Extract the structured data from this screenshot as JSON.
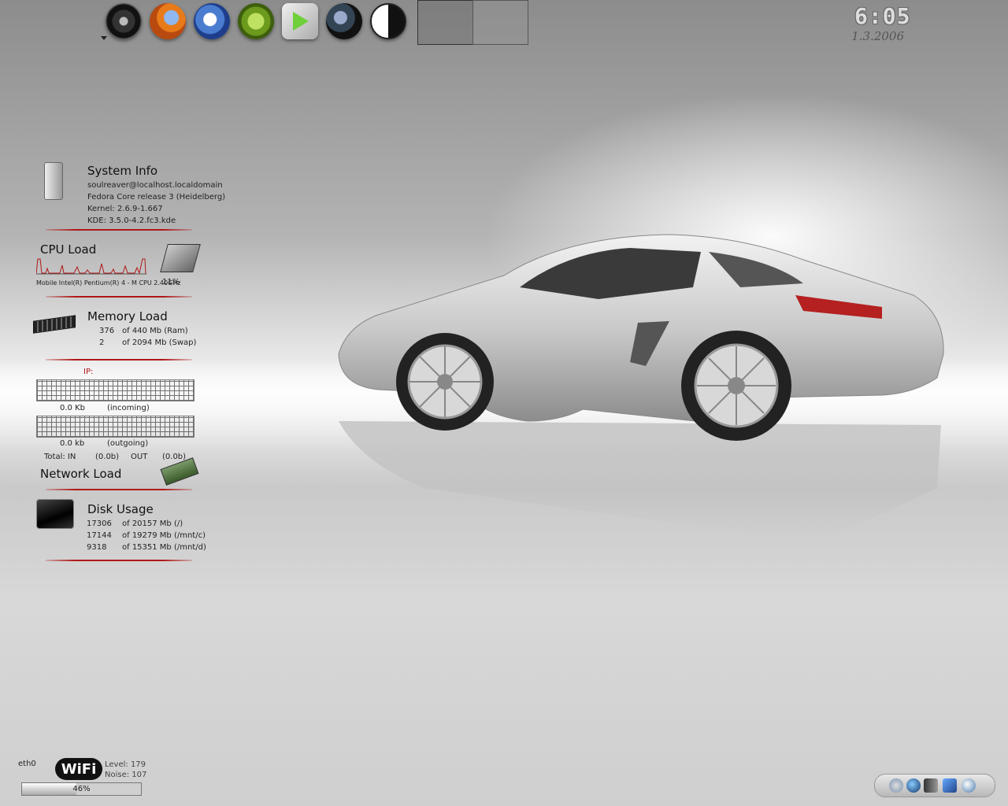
{
  "clock": {
    "time": "6:05",
    "date": "1.3.2006"
  },
  "launcher": {
    "icons": [
      "tire-icon",
      "firefox-icon",
      "thunderbird-icon",
      "cpu-chip-icon",
      "media-player-icon",
      "gaim-icon",
      "yin-yang-icon"
    ]
  },
  "system_info": {
    "title": "System Info",
    "user_host": "soulreaver@localhost.localdomain",
    "os": "Fedora Core release 3 (Heidelberg)",
    "kernel": "Kernel: 2.6.9-1.667",
    "kde": "KDE: 3.5.0-4.2.fc3.kde"
  },
  "cpu": {
    "title": "CPU Load",
    "model": "Mobile Intel(R) Pentium(R) 4 - M CPU 2.40GHz",
    "load": "11%"
  },
  "memory": {
    "title": "Memory Load",
    "ram_used": "376",
    "ram_total": "of 440 Mb (Ram)",
    "swap_used": "2",
    "swap_total": "of 2094 Mb (Swap)"
  },
  "network": {
    "title": "Network Load",
    "ip_label": "IP:",
    "incoming_value": "0.0 Kb",
    "incoming_label": "(incoming)",
    "outgoing_value": "0.0 kb",
    "outgoing_label": "(outgoing)",
    "total_in_label": "Total: IN",
    "total_in_value": "(0.0b)",
    "total_out_label": "OUT",
    "total_out_value": "(0.0b)"
  },
  "disk": {
    "title": "Disk Usage",
    "rows": [
      {
        "used": "17306",
        "total": "of 20157 Mb (/)"
      },
      {
        "used": "17144",
        "total": "of 19279 Mb (/mnt/c)"
      },
      {
        "used": "9318",
        "total": "of 15351 Mb (/mnt/d)"
      }
    ]
  },
  "wifi": {
    "interface": "eth0",
    "logo": "WiFi",
    "level": "Level: 179",
    "noise": "Noise: 107",
    "quality_percent": "46%",
    "quality_value": 0.46
  },
  "tray": {
    "icons": [
      "speaker-icon",
      "globe-icon",
      "battery-plug-icon",
      "network-icon",
      "satellite-icon"
    ]
  }
}
